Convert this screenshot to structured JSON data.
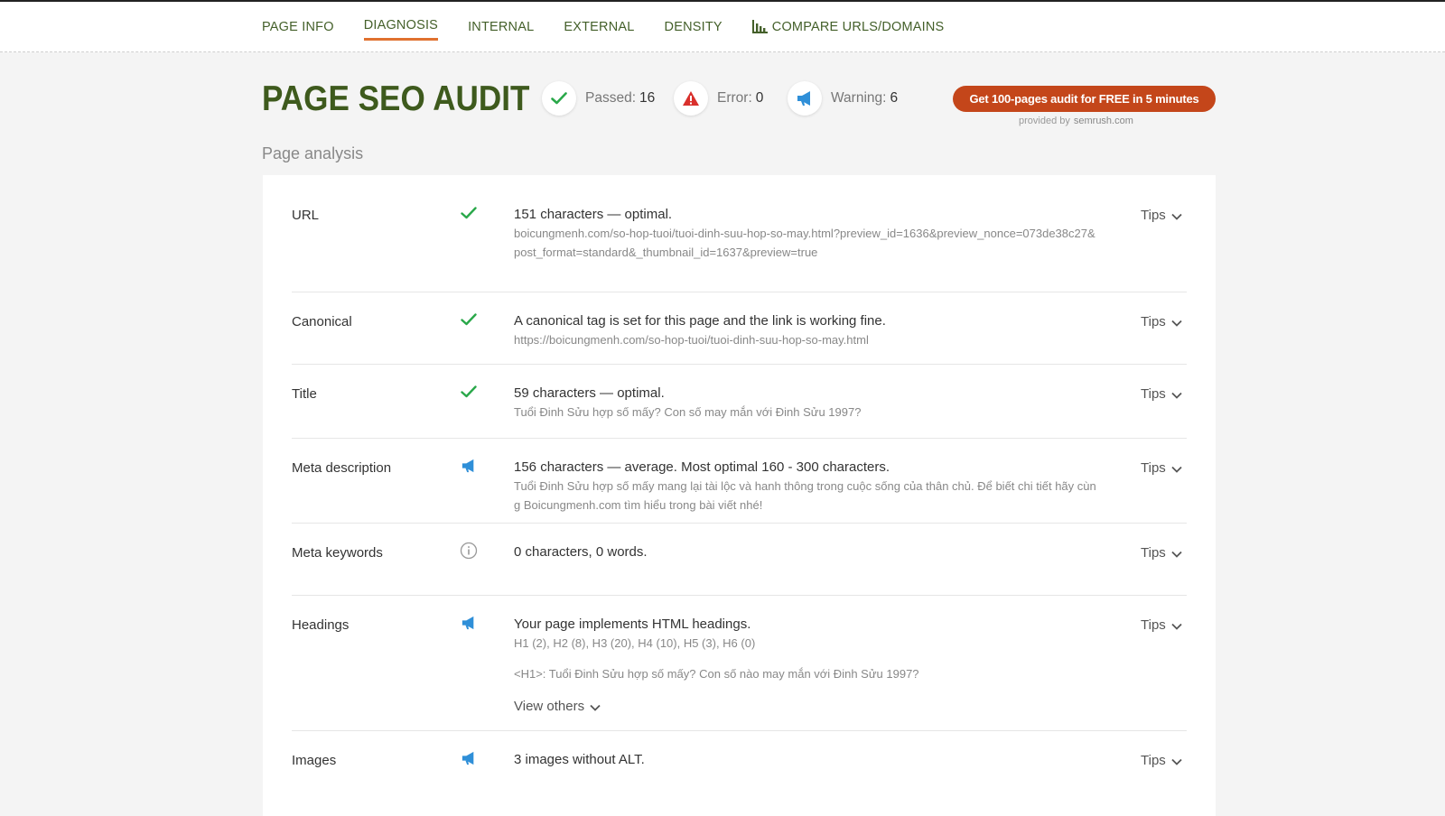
{
  "nav": {
    "items": [
      "PAGE INFO",
      "DIAGNOSIS",
      "INTERNAL",
      "EXTERNAL",
      "DENSITY",
      "COMPARE URLS/DOMAINS"
    ],
    "active": "DIAGNOSIS"
  },
  "header": {
    "title": "PAGE SEO AUDIT",
    "passed_label": "Passed:",
    "passed_count": "16",
    "error_label": "Error:",
    "error_count": "0",
    "warning_label": "Warning:",
    "warning_count": "6",
    "cta_label": "Get 100-pages audit for FREE in 5 minutes",
    "provided_by": "provided by",
    "provider": "semrush.com"
  },
  "section_title": "Page analysis",
  "tips_label": "Tips",
  "rows": [
    {
      "label": "URL",
      "status": "passed",
      "main": "151 characters — optimal.",
      "sub": "boicungmenh.com/so-hop-tuoi/tuoi-dinh-suu-hop-so-may.html?preview_id=1636&preview_nonce=073de38c27&post_format=standard&_thumbnail_id=1637&preview=true"
    },
    {
      "label": "Canonical",
      "status": "passed",
      "main": "A canonical tag is set for this page and the link is working fine.",
      "sub": "https://boicungmenh.com/so-hop-tuoi/tuoi-dinh-suu-hop-so-may.html"
    },
    {
      "label": "Title",
      "status": "passed",
      "main": "59 characters — optimal.",
      "sub": "Tuổi Đinh Sửu hợp số mấy? Con số may mắn với Đinh Sửu 1997?"
    },
    {
      "label": "Meta description",
      "status": "warning",
      "main": "156 characters — average. Most optimal 160 - 300 characters.",
      "sub": "Tuổi Đinh Sửu hợp số mấy mang lại tài lộc và hanh thông trong cuộc sống của thân chủ. Để biết chi tiết hãy cùng Boicungmenh.com tìm hiểu trong bài viết nhé!"
    },
    {
      "label": "Meta keywords",
      "status": "info",
      "main": "0 characters, 0 words.",
      "sub": ""
    },
    {
      "label": "Headings",
      "status": "warning",
      "main": "Your page implements HTML headings.",
      "sub": "H1 (2), H2 (8), H3 (20), H4 (10), H5 (3), H6 (0)",
      "sub2": "<H1>: Tuổi Đinh Sửu hợp số mấy? Con số nào may mắn với Đinh Sửu 1997?",
      "view_others": "View others"
    },
    {
      "label": "Images",
      "status": "warning",
      "main": "3 images without ALT.",
      "sub": ""
    }
  ],
  "colors": {
    "accent": "#e0712f",
    "title_green": "#3e5a1d",
    "check_green": "#2aa84a",
    "error_red": "#d9302c",
    "warning_blue": "#2f8fd8",
    "cta_bg": "#c4461a"
  },
  "icons": {
    "passed": "check-icon",
    "error": "warning-triangle-icon",
    "warning": "megaphone-icon",
    "info": "info-circle-icon",
    "compare": "bar-chart-icon",
    "expand": "chevron-down-icon"
  }
}
